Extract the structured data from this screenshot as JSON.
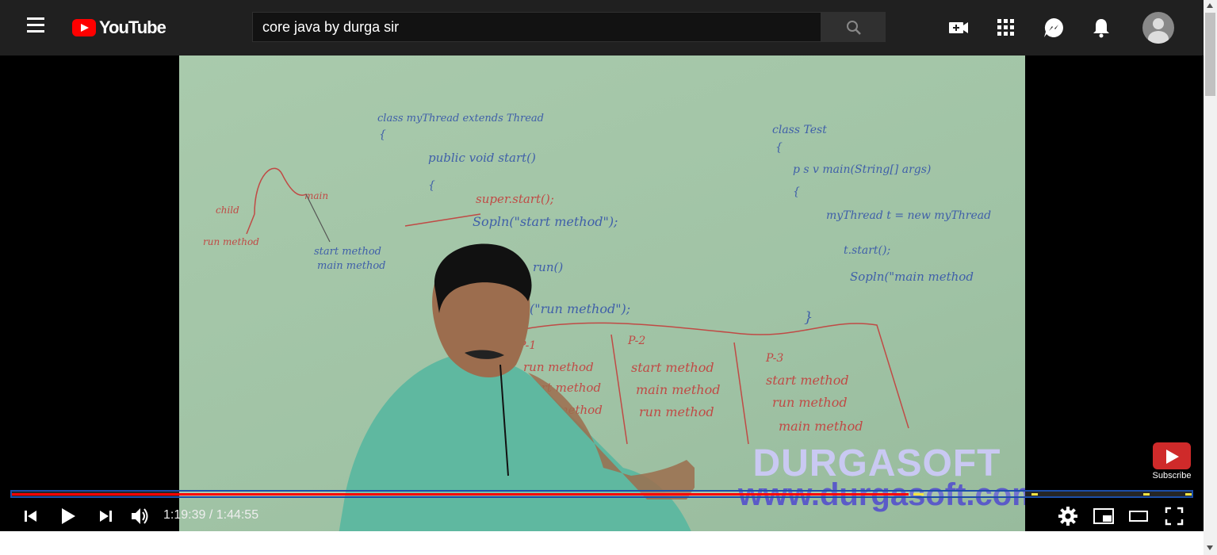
{
  "header": {
    "logo_text": "YouTube",
    "search_value": "core java by durga sir",
    "icons": [
      "menu-icon",
      "youtube-logo",
      "search-icon",
      "create-video-icon",
      "apps-grid-icon",
      "messages-icon",
      "notifications-bell-icon",
      "avatar"
    ]
  },
  "video": {
    "watermark_line1": "DURGASOFT",
    "watermark_line2": "www.durgasoft.com",
    "subscribe_label": "Subscribe",
    "current_time": "1:19:39",
    "duration": "1:44:55",
    "time_display": "1:19:39 / 1:44:55",
    "progress_fraction": 0.76,
    "chapter_markers": [
      0.767,
      0.77,
      0.867,
      0.962,
      1.0
    ],
    "board_text": {
      "class_decl": "class myThread extends Thread",
      "brace1": "{",
      "public_start": "public void start()",
      "brace2": "{",
      "super_start": "super.start();",
      "sopln_start": "Sopln(\"start method\");",
      "run_method_decl": "run()",
      "sopln_run": "(\"run method\");",
      "child": "child",
      "main": "main",
      "run_method": "run method",
      "start_method": "start method",
      "main_method": "main method",
      "class_test": "class Test",
      "test_brace": "{",
      "p_main": "p s v main(String[] args)",
      "test_brace2": "{",
      "mythread_new": "myThread t = new myThread",
      "t_start": "t.start();",
      "sopln_main": "Sopln(\"main method",
      "close_brace": "}",
      "p1": "P-1",
      "p1_a": "run method",
      "p1_b": "start method",
      "p1_c": "main method",
      "p2": "P-2",
      "p2_a": "start method",
      "p2_b": "main method",
      "p2_c": "run method",
      "p3": "P-3",
      "p3_a": "start method",
      "p3_b": "run method",
      "p3_c": "main method"
    }
  },
  "colors": {
    "header_bg": "#202020",
    "progress_played": "#ff0000",
    "progress_marker": "#f3e343",
    "brand_red": "#ff0000"
  }
}
